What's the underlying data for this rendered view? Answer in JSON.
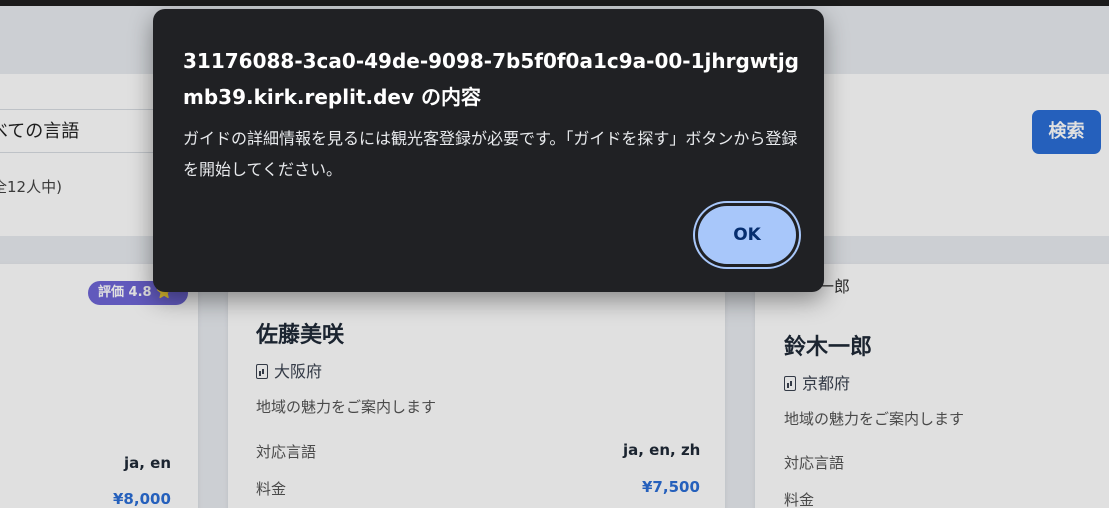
{
  "search": {
    "language_select_value": "べての言語",
    "result_count": "全12人中)",
    "search_button": "検索"
  },
  "cards": [
    {
      "rating_badge": "評価 4.8 ⭐",
      "languages": "ja, en",
      "price": "¥8,000"
    },
    {
      "name": "佐藤美咲",
      "location": "大阪府",
      "description": "地域の魅力をご案内します",
      "languages_label": "対応言語",
      "languages": "ja, en, zh",
      "price_label": "料金",
      "price": "¥7,500"
    },
    {
      "partial_name": "一郎",
      "name": "鈴木一郎",
      "location": "京都府",
      "description": "地域の魅力をご案内します",
      "languages_label": "対応言語",
      "price_label": "料金"
    }
  ],
  "dialog": {
    "title": "31176088-3ca0-49de-9098-7b5f0f0a1c9a-00-1jhrgwtjgmb39.kirk.replit.dev の内容",
    "message": "ガイドの詳細情報を見るには観光客登録が必要です。「ガイドを探す」ボタンから登録を開始してください。",
    "ok_button": "OK"
  },
  "colors": {
    "primary": "#2b6ed6",
    "badge": "#6f66d6",
    "dialog_bg": "#202124",
    "ok_button": "#a8c7fa"
  }
}
